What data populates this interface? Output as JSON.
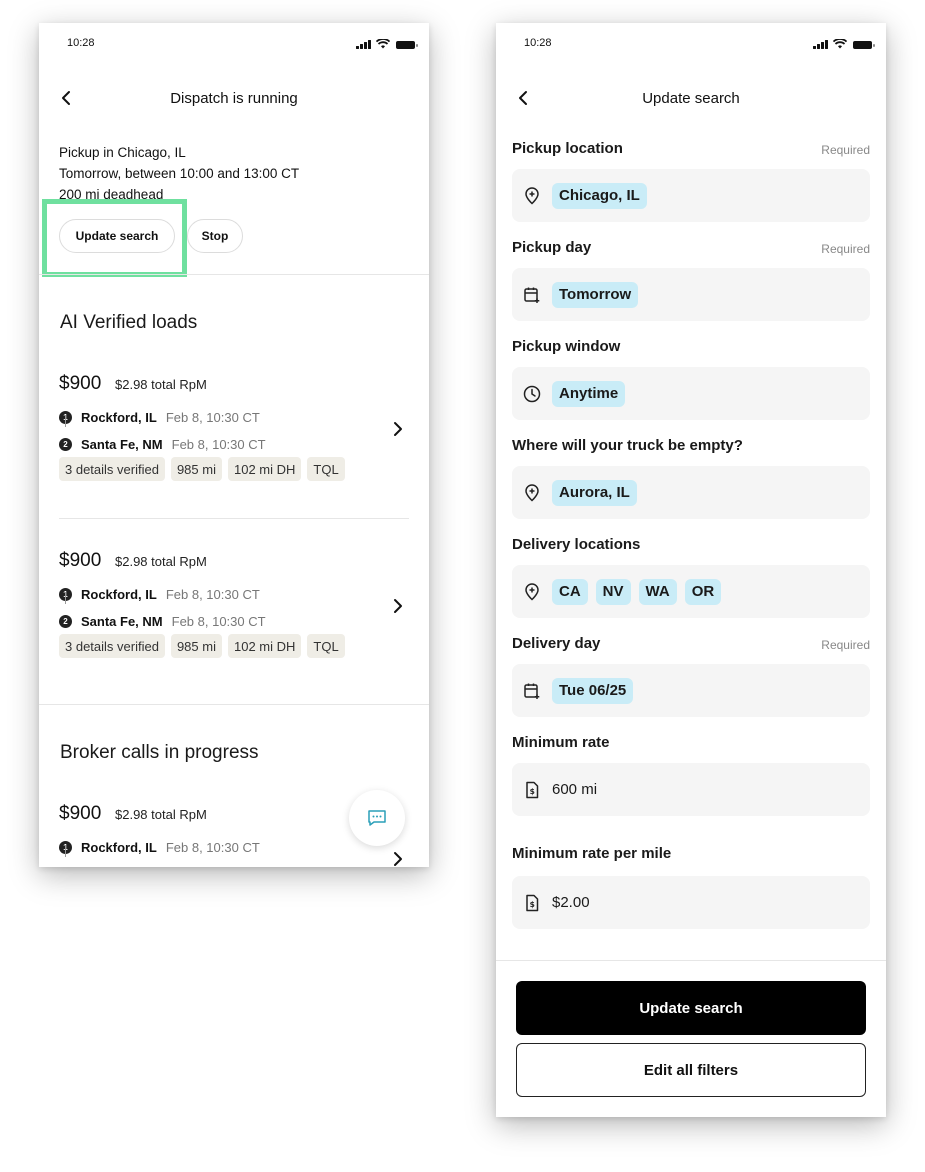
{
  "left": {
    "status_time": "10:28",
    "nav_title": "Dispatch is running",
    "pickup_lines": [
      "Pickup in Chicago, IL",
      "Tomorrow, between 10:00 and 13:00 CT",
      "200 mi deadhead"
    ],
    "update_button": "Update search",
    "stop_button": "Stop",
    "section_verified": "AI Verified loads",
    "section_broker": "Broker calls in progress",
    "loads": [
      {
        "price": "$900",
        "rpm": "$2.98 total RpM",
        "stops": [
          {
            "num": "1",
            "city": "Rockford, IL",
            "time": "Feb 8, 10:30 CT"
          },
          {
            "num": "2",
            "city": "Santa Fe, NM",
            "time": "Feb 8, 10:30 CT"
          }
        ],
        "tags": [
          "3 details verified",
          "985 mi",
          "102 mi DH",
          "TQL"
        ]
      },
      {
        "price": "$900",
        "rpm": "$2.98 total RpM",
        "stops": [
          {
            "num": "1",
            "city": "Rockford, IL",
            "time": "Feb 8, 10:30 CT"
          },
          {
            "num": "2",
            "city": "Santa Fe, NM",
            "time": "Feb 8, 10:30 CT"
          }
        ],
        "tags": [
          "3 details verified",
          "985 mi",
          "102 mi DH",
          "TQL"
        ]
      },
      {
        "price": "$900",
        "rpm": "$2.98 total RpM",
        "stops": [
          {
            "num": "1",
            "city": "Rockford, IL",
            "time": "Feb 8, 10:30 CT"
          }
        ],
        "tags": []
      }
    ]
  },
  "right": {
    "status_time": "10:28",
    "nav_title": "Update search",
    "required_label": "Required",
    "fields": {
      "pickup_location": {
        "label": "Pickup location",
        "chips": [
          "Chicago, IL"
        ]
      },
      "pickup_day": {
        "label": "Pickup day",
        "chips": [
          "Tomorrow"
        ]
      },
      "pickup_window": {
        "label": "Pickup window",
        "chips": [
          "Anytime"
        ]
      },
      "empty_location": {
        "label": "Where will your truck be empty?",
        "chips": [
          "Aurora, IL"
        ]
      },
      "delivery_locations": {
        "label": "Delivery locations",
        "chips": [
          "CA",
          "NV",
          "WA",
          "OR"
        ]
      },
      "delivery_day": {
        "label": "Delivery day",
        "chips": [
          "Tue 06/25"
        ]
      },
      "min_rate": {
        "label": "Minimum rate",
        "value": "600 mi"
      },
      "min_rate_per_mile": {
        "label": "Minimum rate per mile",
        "value": "$2.00"
      }
    },
    "primary_button": "Update search",
    "secondary_button": "Edit all filters"
  },
  "colors": {
    "highlight": "#6fe09f",
    "chip": "#c9ecf7",
    "tag": "#efede6",
    "field_bg": "#f5f5f5",
    "fab_icon": "#2a9fb8"
  }
}
